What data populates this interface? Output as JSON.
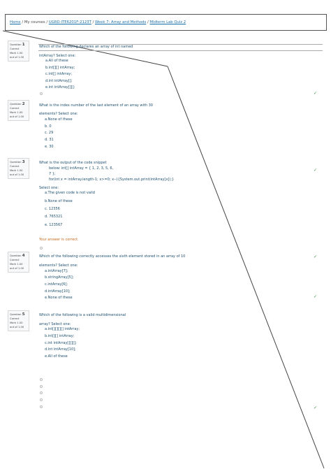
{
  "breadcrumb": {
    "home": "Home",
    "sep": "/",
    "my_courses": "My courses",
    "course": "UGRD-ITE6201F-2123T",
    "week": "Week 7: Array and Methods",
    "quiz": "Midterm Lab Quiz 2"
  },
  "questions": [
    {
      "label": "Question",
      "number": "1",
      "state": "Correct",
      "mark": "Mark 1.00 out of 1.00",
      "text": "Which of the following declares an array of int named",
      "text2": "intArray? Select one:",
      "options": [
        "a.All of these",
        "b.int[][] intArray;",
        "c.int[] intArray;",
        "d.int intArray[];",
        "e.int intArray[][];"
      ]
    },
    {
      "label": "Question",
      "number": "2",
      "state": "Correct",
      "mark": "Mark 1.00 out of 1.00",
      "text": "What is the index number of the last element of an array with 30",
      "text2": "elements? Select one:",
      "options": [
        "a.None of these",
        "b. 0",
        "c. 29",
        "d. 31",
        "e. 30"
      ]
    },
    {
      "label": "Question",
      "number": "3",
      "state": "Correct",
      "mark": "Mark 1.00 out of 1.00",
      "text": "What is the output of the code snippet",
      "code": [
        "below: int[] intArray = { 1, 2, 3, 5, 6,",
        "7 };",
        "for(int x = intArray.length-1; x>=0; x--){System.out.print(intArray[x]);}"
      ],
      "text2": "Select one:",
      "options": [
        "a.The given code is not valid",
        "b.None of these",
        "c. 12356",
        "d. 765321",
        "e. 123567"
      ],
      "feedback": "Your answer is correct."
    },
    {
      "label": "Question",
      "number": "4",
      "state": "Correct",
      "mark": "Mark 1.00 out of 1.00",
      "text": "Which of the following correctly accesses the sixth element stored in an array of 10",
      "text2": "elements? Select one:",
      "options": [
        "a.intArray[7];",
        "b.stringArray[5];",
        "c.intArray[6];",
        "d.intArray[10];",
        "e.None of these"
      ]
    },
    {
      "label": "Question",
      "number": "5",
      "state": "Correct",
      "mark": "Mark 1.00 out of 1.00",
      "text": "Which of the following is a valid multidimensional",
      "text2": "array? Select one:",
      "options": [
        "a.int[][][][] intArray;",
        "b.int[][] intArray;",
        "c.int intArray[][][];",
        "d.int intArray[10];",
        "e.All of these"
      ]
    }
  ],
  "check_mark": "✓"
}
